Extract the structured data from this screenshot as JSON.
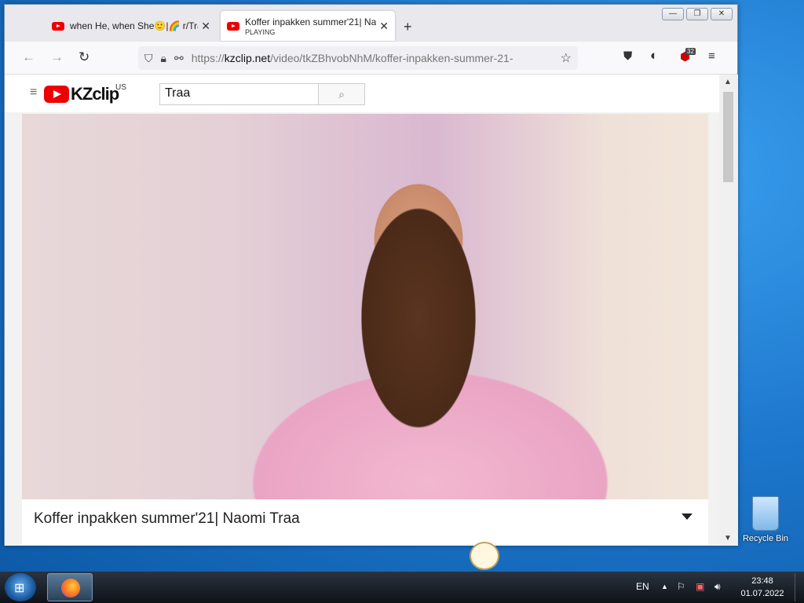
{
  "browser": {
    "tabs": [
      {
        "title": "when He, when She🙂|🌈 r/Tra",
        "sub": ""
      },
      {
        "title": "Koffer inpakken summer'21| Na",
        "sub": "PLAYING"
      }
    ],
    "new_tab": "+",
    "window_buttons": {
      "minimize": "—",
      "restore": "❐",
      "close": "✕"
    },
    "url_prefix": "https://",
    "url_host": "kzclip.net",
    "url_path": "/video/tkZBhvobNhM/koffer-inpakken-summer-21-",
    "badge_count": "32"
  },
  "site": {
    "logo_name": "KZclip",
    "region": "US",
    "search_value": "Traa"
  },
  "video": {
    "title": "Koffer inpakken summer'21| Naomi Traa"
  },
  "desktop": {
    "recycle_bin": "Recycle Bin"
  },
  "taskbar": {
    "language": "EN",
    "time": "23:48",
    "date": "01.07.2022"
  }
}
